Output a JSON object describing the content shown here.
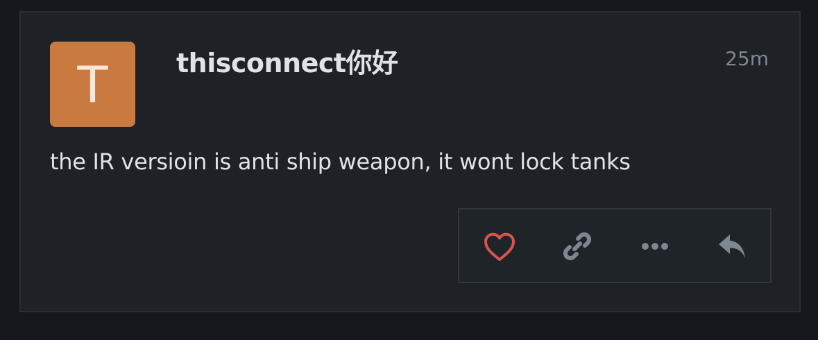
{
  "post": {
    "avatar": {
      "letter": "T",
      "color": "#c87a41"
    },
    "username": "thisconnect你好",
    "timestamp": "25m",
    "body": "the IR versioin is anti ship weapon, it wont lock tanks"
  },
  "actions": [
    {
      "icon": "heart-icon",
      "color": "#d9534f"
    },
    {
      "icon": "link-icon",
      "color": "#7c8790"
    },
    {
      "icon": "more-horizontal-icon",
      "color": "#7c8790"
    },
    {
      "icon": "reply-arrow-icon",
      "color": "#7c8790"
    }
  ],
  "colors": {
    "page_background": "#15191d",
    "card_background": "#1e2226",
    "text_primary": "#dfe3e7",
    "text_muted": "#7c8790"
  }
}
